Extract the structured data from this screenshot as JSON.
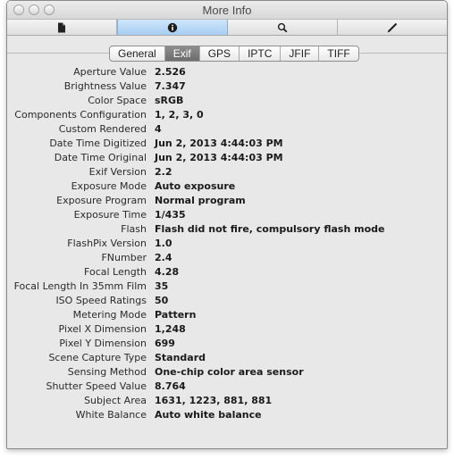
{
  "window": {
    "title": "More Info"
  },
  "toolbar": {
    "tools": [
      {
        "name": "document-icon"
      },
      {
        "name": "info-icon"
      },
      {
        "name": "magnifier-icon"
      },
      {
        "name": "pencil-icon"
      }
    ],
    "active_tool": "info-icon"
  },
  "tabs": {
    "items": [
      "General",
      "Exif",
      "GPS",
      "IPTC",
      "JFIF",
      "TIFF"
    ],
    "selected": "Exif"
  },
  "exif": {
    "rows": [
      {
        "label": "Aperture Value",
        "value": "2.526"
      },
      {
        "label": "Brightness Value",
        "value": "7.347"
      },
      {
        "label": "Color Space",
        "value": "sRGB"
      },
      {
        "label": "Components Configuration",
        "value": "1, 2, 3, 0"
      },
      {
        "label": "Custom Rendered",
        "value": "4"
      },
      {
        "label": "Date Time Digitized",
        "value": "Jun 2, 2013 4:44:03 PM"
      },
      {
        "label": "Date Time Original",
        "value": "Jun 2, 2013 4:44:03 PM"
      },
      {
        "label": "Exif Version",
        "value": "2.2"
      },
      {
        "label": "Exposure Mode",
        "value": "Auto exposure"
      },
      {
        "label": "Exposure Program",
        "value": "Normal program"
      },
      {
        "label": "Exposure Time",
        "value": "1/435"
      },
      {
        "label": "Flash",
        "value": "Flash did not fire, compulsory flash mode"
      },
      {
        "label": "FlashPix Version",
        "value": "1.0"
      },
      {
        "label": "FNumber",
        "value": "2.4"
      },
      {
        "label": "Focal Length",
        "value": "4.28"
      },
      {
        "label": "Focal Length In 35mm Film",
        "value": "35"
      },
      {
        "label": "ISO Speed Ratings",
        "value": "50"
      },
      {
        "label": "Metering Mode",
        "value": "Pattern"
      },
      {
        "label": "Pixel X Dimension",
        "value": "1,248"
      },
      {
        "label": "Pixel Y Dimension",
        "value": "699"
      },
      {
        "label": "Scene Capture Type",
        "value": "Standard"
      },
      {
        "label": "Sensing Method",
        "value": "One-chip color area sensor"
      },
      {
        "label": "Shutter Speed Value",
        "value": "8.764"
      },
      {
        "label": "Subject Area",
        "value": "1631, 1223, 881, 881"
      },
      {
        "label": "White Balance",
        "value": "Auto white balance"
      }
    ]
  }
}
